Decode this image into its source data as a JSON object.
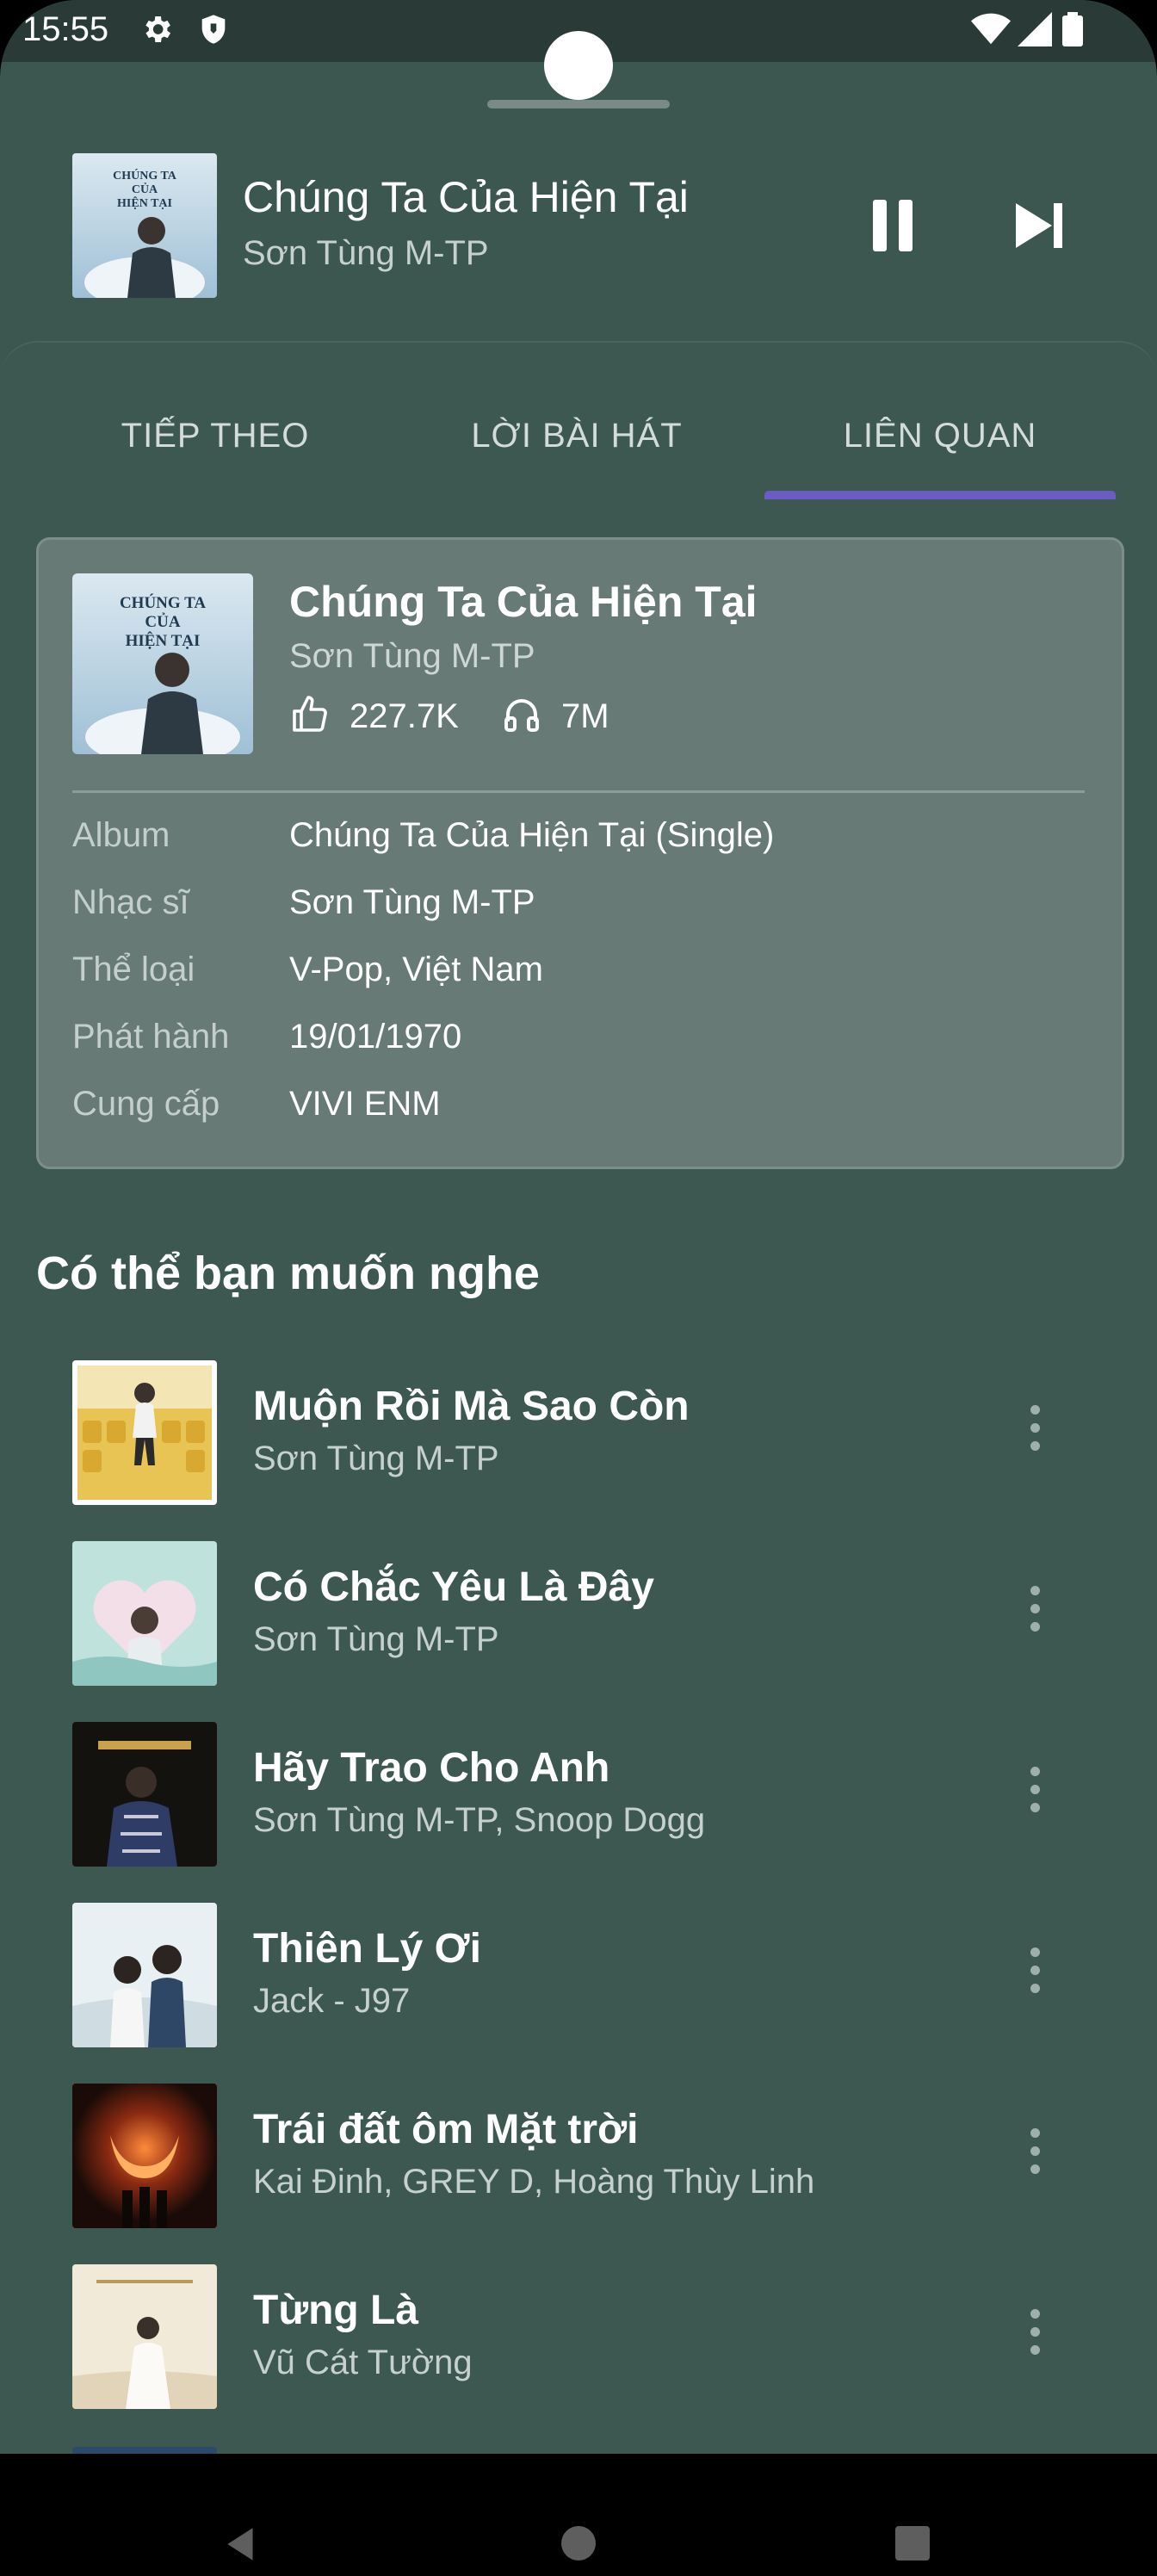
{
  "status_bar": {
    "time": "15:55",
    "icons": [
      "gear-icon",
      "shield-icon",
      "wifi-icon",
      "signal-icon",
      "battery-icon"
    ]
  },
  "now_playing": {
    "title": "Chúng Ta Của Hiện Tại",
    "artist": "Sơn Tùng M-TP",
    "art_text": "CHÚNG TA CỦA HIỆN TẠI",
    "controls": [
      "pause-icon",
      "skip-next-icon"
    ]
  },
  "tabs": [
    {
      "label": "TIẾP THEO",
      "selected": false
    },
    {
      "label": "LỜI BÀI HÁT",
      "selected": false
    },
    {
      "label": "LIÊN QUAN",
      "selected": true
    }
  ],
  "accent_color": "#6d5bc4",
  "song_info": {
    "title": "Chúng Ta Của Hiện Tại",
    "artist": "Sơn Tùng M-TP",
    "likes": "227.7K",
    "listens": "7M",
    "art_text": "CHÚNG TA CỦA HIỆN TẠI",
    "meta": [
      {
        "label": "Album",
        "value": "Chúng Ta Của Hiện Tại (Single)"
      },
      {
        "label": "Nhạc sĩ",
        "value": "Sơn Tùng M-TP"
      },
      {
        "label": "Thể loại",
        "value": "V-Pop, Việt Nam"
      },
      {
        "label": "Phát hành",
        "value": "19/01/1970"
      },
      {
        "label": "Cung cấp",
        "value": "VIVI ENM"
      }
    ]
  },
  "suggestions": {
    "title": "Có thể bạn muốn nghe",
    "songs": [
      {
        "title": "Muộn Rồi Mà Sao Còn",
        "artist": "Sơn Tùng M-TP"
      },
      {
        "title": "Có Chắc Yêu Là Đây",
        "artist": "Sơn Tùng M-TP"
      },
      {
        "title": "Hãy Trao Cho Anh",
        "artist": "Sơn Tùng M-TP, Snoop Dogg"
      },
      {
        "title": "Thiên Lý Ơi",
        "artist": "Jack - J97"
      },
      {
        "title": "Trái đất ôm Mặt trời",
        "artist": "Kai Đinh, GREY D, Hoàng Thùy Linh"
      },
      {
        "title": "Từng Là",
        "artist": "Vũ Cát Tường"
      }
    ]
  },
  "nav_bar": {
    "buttons": [
      "back-icon",
      "home-icon",
      "recents-icon"
    ]
  }
}
